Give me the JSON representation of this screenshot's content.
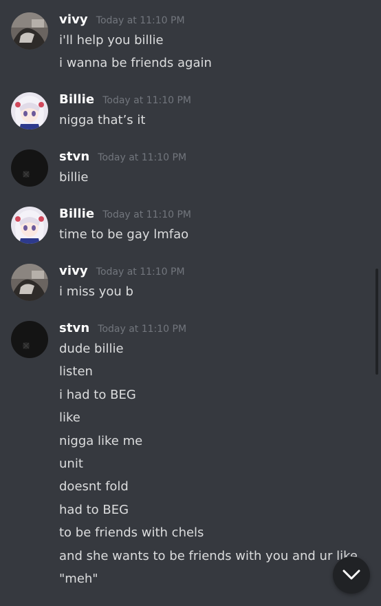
{
  "messages": [
    {
      "username": "vivy",
      "timestamp": "Today at 11:10 PM",
      "avatar": "vivy-avatar",
      "lines": [
        "i'll help you billie",
        "i wanna be friends again"
      ]
    },
    {
      "username": "Billie",
      "timestamp": "Today at 11:10 PM",
      "avatar": "anime-girl-avatar",
      "lines": [
        "nigga that’s it"
      ]
    },
    {
      "username": "stvn",
      "timestamp": "Today at 11:10 PM",
      "avatar": "dark-avatar",
      "lines": [
        "billie"
      ]
    },
    {
      "username": "Billie",
      "timestamp": "Today at 11:10 PM",
      "avatar": "anime-girl-avatar",
      "lines": [
        "time to be gay lmfao"
      ]
    },
    {
      "username": "vivy",
      "timestamp": "Today at 11:10 PM",
      "avatar": "vivy-avatar",
      "lines": [
        "i miss you b"
      ]
    },
    {
      "username": "stvn",
      "timestamp": "Today at 11:10 PM",
      "avatar": "dark-avatar",
      "lines": [
        "dude billie",
        "listen",
        "i had to BEG",
        "like",
        "nigga like me",
        "unit",
        "doesnt fold",
        "had to BEG",
        "to be friends with chels",
        "and she wants to be friends with you and ur like",
        "\"meh\""
      ]
    }
  ],
  "jump_button_icon": "chevron-down-icon",
  "colors": {
    "background": "#36393f",
    "username": "#ffffff",
    "message_text": "#dcddde",
    "timestamp": "#72767d",
    "button_bg": "#202225"
  }
}
